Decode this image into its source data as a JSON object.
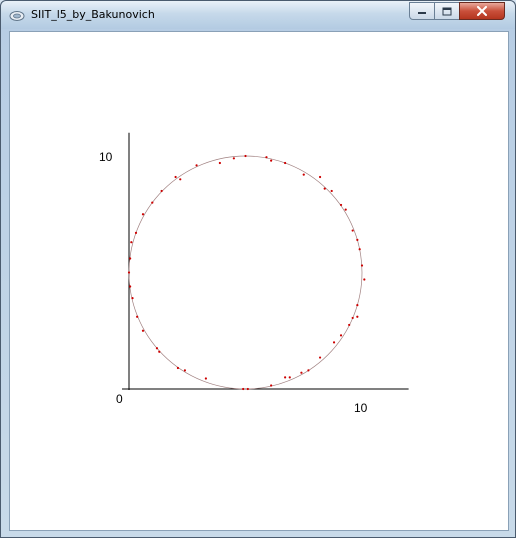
{
  "window": {
    "title": "SIIT_l5_by_Bakunovich",
    "buttons": {
      "minimize": "minimize",
      "maximize": "maximize",
      "close": "close"
    }
  },
  "chart_data": {
    "type": "scatter",
    "title": "",
    "xlabel": "",
    "ylabel": "",
    "xlim": [
      0,
      12
    ],
    "ylim": [
      0,
      11
    ],
    "x_ticks": [
      "0",
      "10"
    ],
    "y_ticks": [
      "10"
    ],
    "origin_label": "0",
    "circle": {
      "center": [
        5,
        5
      ],
      "radius": 5,
      "color": "#a08080"
    },
    "point_color": "#cc0000",
    "points": [
      [
        0.0,
        5.0
      ],
      [
        0.05,
        5.6
      ],
      [
        0.1,
        6.3
      ],
      [
        0.3,
        6.7
      ],
      [
        0.6,
        7.5
      ],
      [
        1.0,
        8.0
      ],
      [
        1.4,
        8.5
      ],
      [
        2.0,
        9.1
      ],
      [
        2.2,
        9.0
      ],
      [
        2.9,
        9.6
      ],
      [
        3.9,
        9.7
      ],
      [
        4.5,
        9.9
      ],
      [
        5.0,
        10.0
      ],
      [
        5.9,
        9.95
      ],
      [
        6.1,
        9.8
      ],
      [
        6.7,
        9.7
      ],
      [
        7.5,
        9.2
      ],
      [
        8.2,
        9.1
      ],
      [
        8.4,
        8.6
      ],
      [
        8.7,
        8.5
      ],
      [
        9.1,
        7.9
      ],
      [
        9.3,
        7.7
      ],
      [
        9.6,
        6.8
      ],
      [
        9.8,
        6.4
      ],
      [
        9.9,
        6.0
      ],
      [
        10.0,
        5.3
      ],
      [
        10.1,
        4.7
      ],
      [
        9.8,
        3.6
      ],
      [
        9.8,
        3.1
      ],
      [
        9.6,
        3.05
      ],
      [
        9.45,
        2.75
      ],
      [
        9.1,
        2.3
      ],
      [
        8.8,
        2.0
      ],
      [
        8.2,
        1.35
      ],
      [
        7.7,
        0.8
      ],
      [
        7.4,
        0.7
      ],
      [
        6.9,
        0.5
      ],
      [
        6.7,
        0.5
      ],
      [
        6.1,
        0.15
      ],
      [
        5.1,
        0.0
      ],
      [
        4.9,
        0.0
      ],
      [
        3.3,
        0.45
      ],
      [
        2.4,
        0.8
      ],
      [
        2.1,
        0.9
      ],
      [
        1.3,
        1.6
      ],
      [
        1.2,
        1.75
      ],
      [
        0.6,
        2.5
      ],
      [
        0.35,
        3.1
      ],
      [
        0.15,
        3.9
      ],
      [
        0.05,
        4.4
      ]
    ]
  }
}
